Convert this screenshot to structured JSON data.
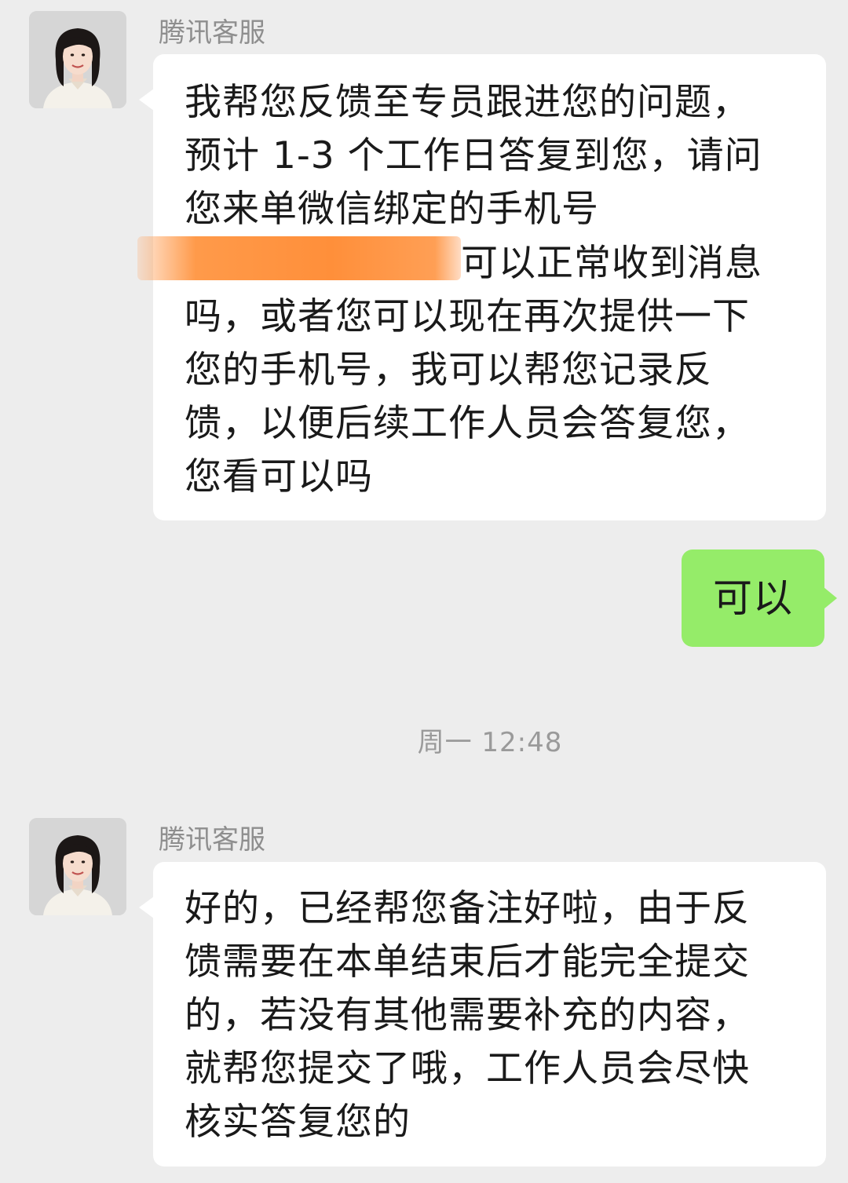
{
  "conversation": {
    "message_1": {
      "sender": "腾讯客服",
      "avatar_icon": "agent-avatar-icon",
      "lines_before_redaction": [
        "我帮您反馈至专员跟进您的问题，",
        "预计 1-3 个工作日答复到您，请问",
        "您来单微信绑定的手机号"
      ],
      "after_redaction": "可以正常收到消息",
      "lines_after": [
        "吗，或者您可以现在再次提供一下",
        "您的手机号，我可以帮您记录反",
        "馈，以便后续工作人员会答复您，",
        "您看可以吗"
      ]
    },
    "reply": {
      "text": "可以"
    },
    "timestamp": "周一 12:48",
    "message_2": {
      "sender": "腾讯客服",
      "avatar_icon": "agent-avatar-icon",
      "lines": [
        "好的，已经帮您备注好啦，由于反",
        "馈需要在本单结束后才能完全提交",
        "的，若没有其他需要补充的内容，",
        "就帮您提交了哦，工作人员会尽快",
        "核实答复您的"
      ]
    }
  },
  "colors": {
    "background": "#ededed",
    "incoming_bubble": "#ffffff",
    "outgoing_bubble": "#95ec69",
    "redaction": "#ff8f3a"
  }
}
